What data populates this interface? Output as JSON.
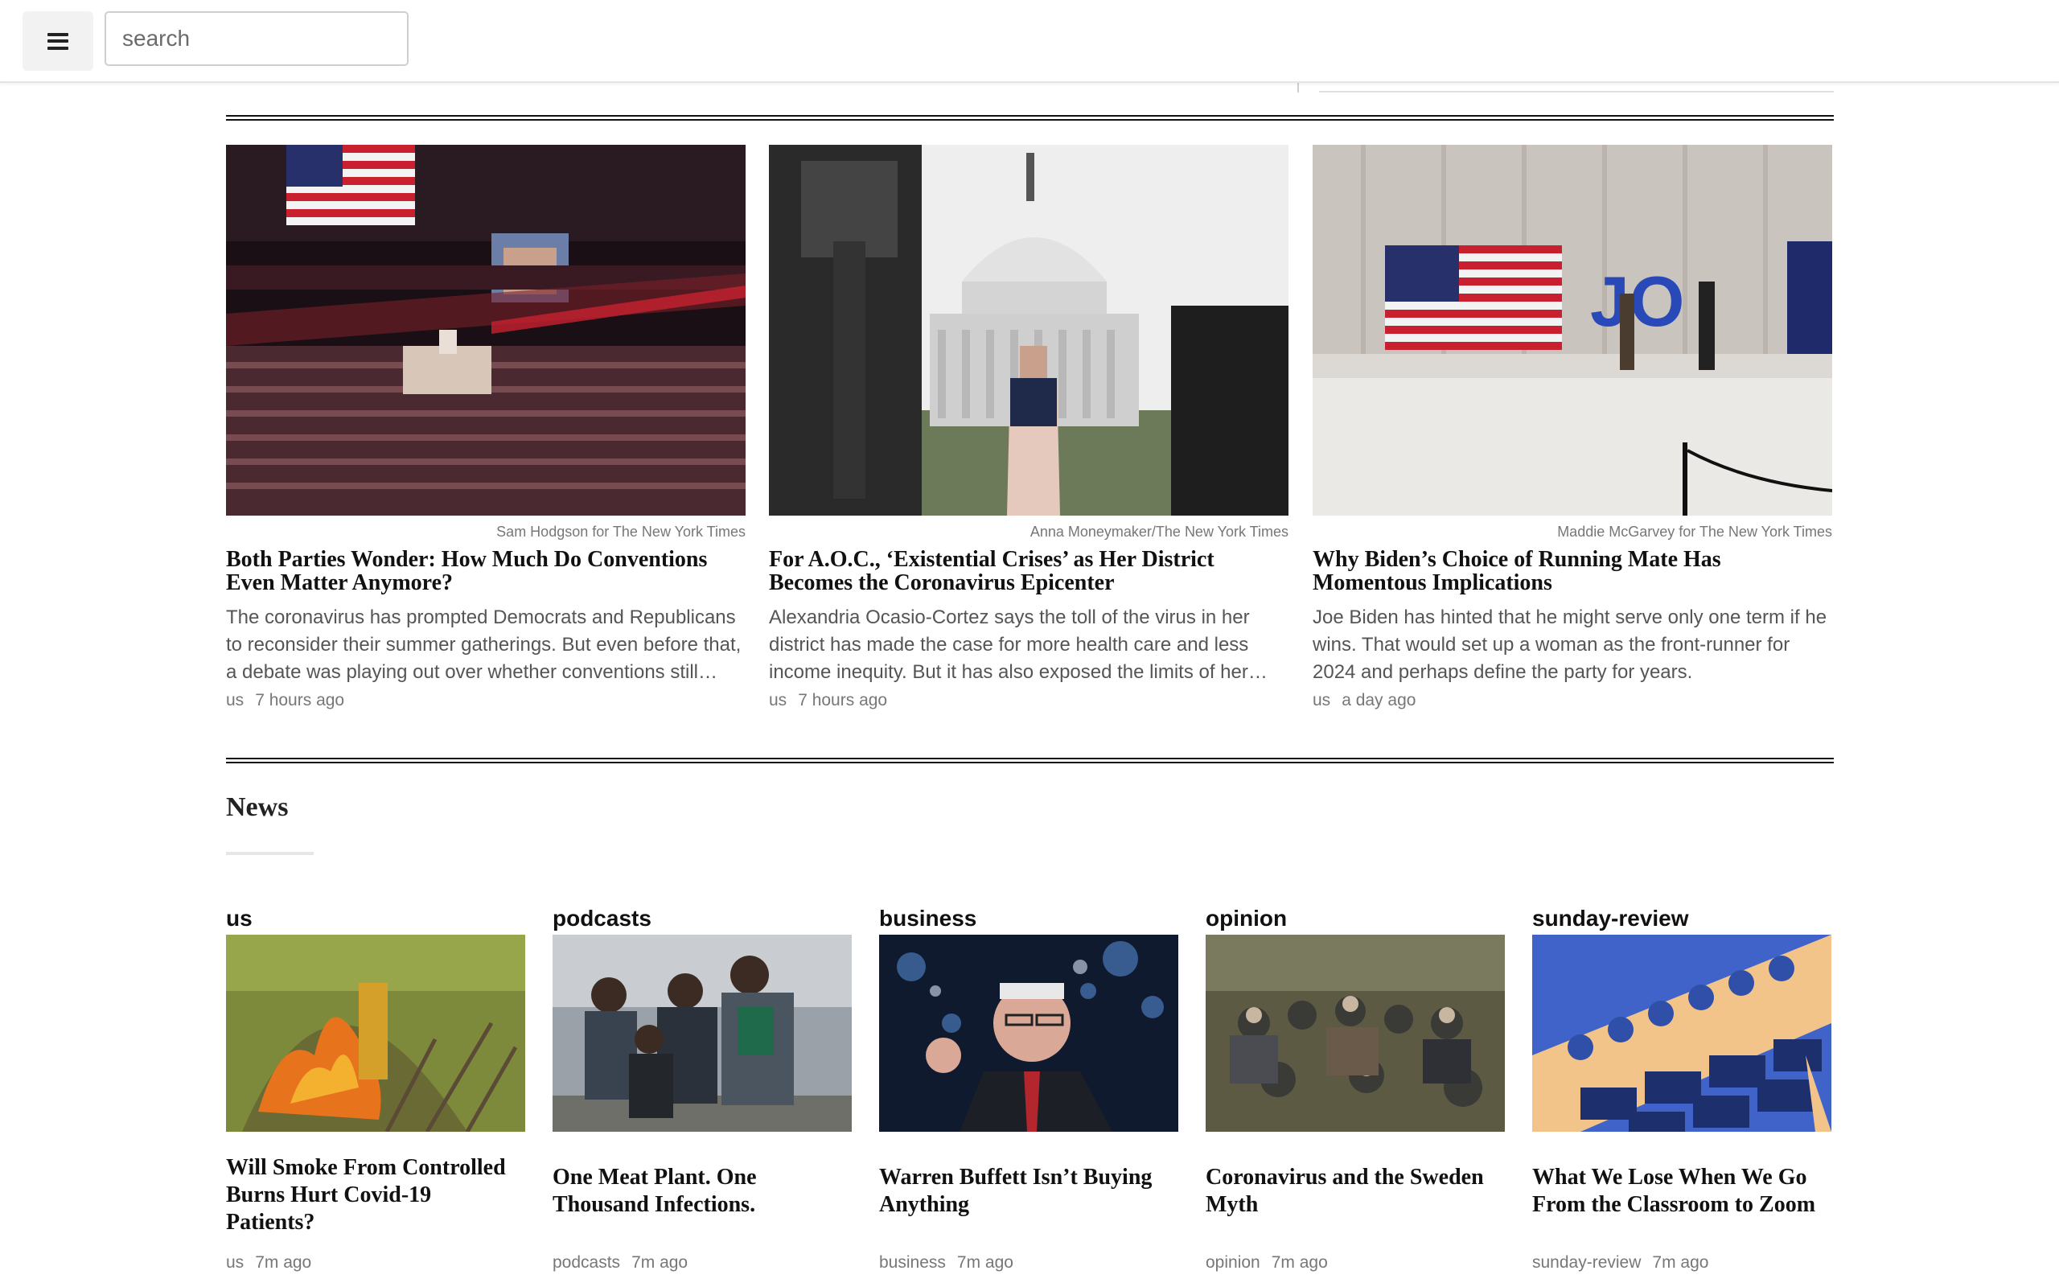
{
  "header": {
    "menu_icon": "hamburger-menu-icon",
    "search_placeholder": "search"
  },
  "top_stories": [
    {
      "credit": "Sam Hodgson for The New York Times",
      "headline": "Both Parties Wonder: How Much Do Conventions Even Matter Anymore?",
      "summary": "The coronavirus has prompted Democrats and Republicans to reconsider their summer gatherings. But even before that, a debate was playing out over whether conventions still matter.",
      "section": "us",
      "time": "7 hours ago"
    },
    {
      "credit": "Anna Moneymaker/The New York Times",
      "headline": "For A.O.C., ‘Existential Crises’ as Her District Becomes the Coronavirus Epicenter",
      "summary": "Alexandria Ocasio-Cortez says the toll of the virus in her district has made the case for more health care and less income inequity. But it has also exposed the limits of her power.",
      "section": "us",
      "time": "7 hours ago"
    },
    {
      "credit": "Maddie McGarvey for The New York Times",
      "headline": "Why Biden’s Choice of Running Mate Has Momentous Implications",
      "summary": "Joe Biden has hinted that he might serve only one term if he wins. That would set up a woman as the front-runner for 2024 and perhaps define the party for years.",
      "section": "us",
      "time": "a day ago"
    }
  ],
  "news": {
    "title": "News",
    "items": [
      {
        "category": "us",
        "title": "Will Smoke From Controlled Burns Hurt Covid-19 Patients?",
        "section": "us",
        "time": "7m ago"
      },
      {
        "category": "podcasts",
        "title": "One Meat Plant. One Thousand Infections.",
        "section": "podcasts",
        "time": "7m ago"
      },
      {
        "category": "business",
        "title": "Warren Buffett Isn’t Buying Anything",
        "section": "business",
        "time": "7m ago"
      },
      {
        "category": "opinion",
        "title": "Coronavirus and the Sweden Myth",
        "section": "opinion",
        "time": "7m ago"
      },
      {
        "category": "sunday-review",
        "title": "What We Lose When We Go From the Classroom to Zoom",
        "section": "sunday-review",
        "time": "7m ago"
      }
    ]
  }
}
